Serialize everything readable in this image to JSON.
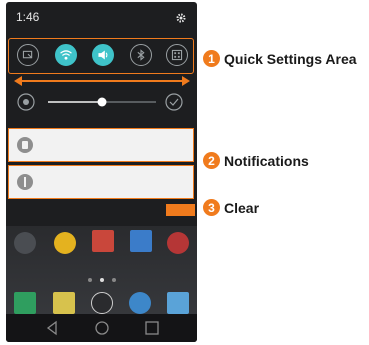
{
  "status_bar": {
    "time": "1:46"
  },
  "quick_settings": {
    "buttons": [
      {
        "name": "screen-capture",
        "on": false
      },
      {
        "name": "wifi",
        "on": true
      },
      {
        "name": "sound",
        "on": true
      },
      {
        "name": "bluetooth",
        "on": false
      },
      {
        "name": "more",
        "on": false
      }
    ]
  },
  "brightness": {
    "level": 0.5
  },
  "labels": {
    "one": {
      "num": "1",
      "text": "Quick Settings Area"
    },
    "two": {
      "num": "2",
      "text": "Notifications"
    },
    "three": {
      "num": "3",
      "text": "Clear"
    }
  },
  "colors": {
    "accent": "#f07b1d",
    "toggle_on": "#3fc3c9"
  }
}
